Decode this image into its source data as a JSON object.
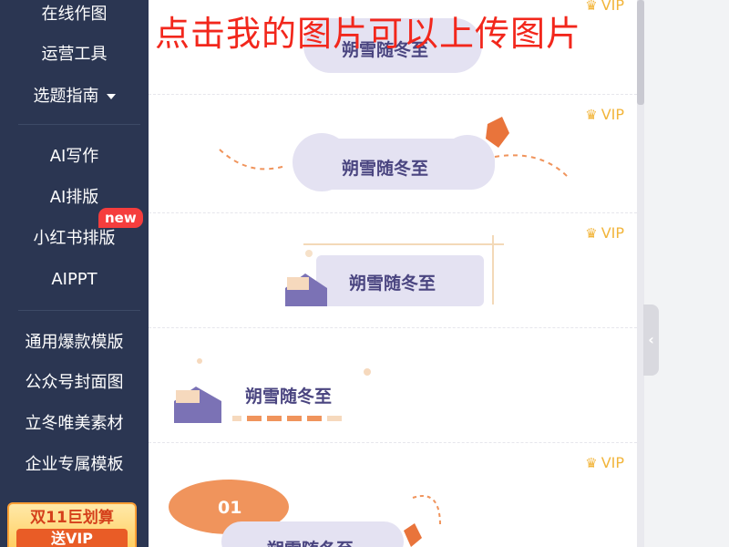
{
  "sidebar": {
    "items": [
      {
        "label": "在线作图"
      },
      {
        "label": "运营工具"
      },
      {
        "label": "选题指南"
      },
      {
        "label": "AI写作"
      },
      {
        "label": "AI排版"
      },
      {
        "label": "小红书排版"
      },
      {
        "label": "AIPPT"
      },
      {
        "label": "通用爆款模版"
      },
      {
        "label": "公众号封面图"
      },
      {
        "label": "立冬唯美素材"
      },
      {
        "label": "企业专属模板"
      }
    ],
    "new_badge": "new",
    "promo": {
      "line1": "双11巨划算",
      "line2": "送VIP"
    }
  },
  "cards": [
    {
      "title": "朔雪随冬至",
      "vip": "VIP"
    },
    {
      "title": "朔雪随冬至",
      "vip": "VIP"
    },
    {
      "title": "朔雪随冬至",
      "vip": "VIP"
    },
    {
      "title": "朔雪随冬至",
      "vip": ""
    },
    {
      "title": "朔雪随冬至",
      "vip": "VIP",
      "number": "01"
    }
  ],
  "overlay_caption": "点击我的图片可以上传图片",
  "collapse_icon": "chevron-left-icon",
  "colors": {
    "sidebar_bg": "#2b3652",
    "accent_red": "#f2271c",
    "vip_gold": "#f2b53b",
    "title_purple": "#4a4580",
    "orange": "#f0945c"
  }
}
